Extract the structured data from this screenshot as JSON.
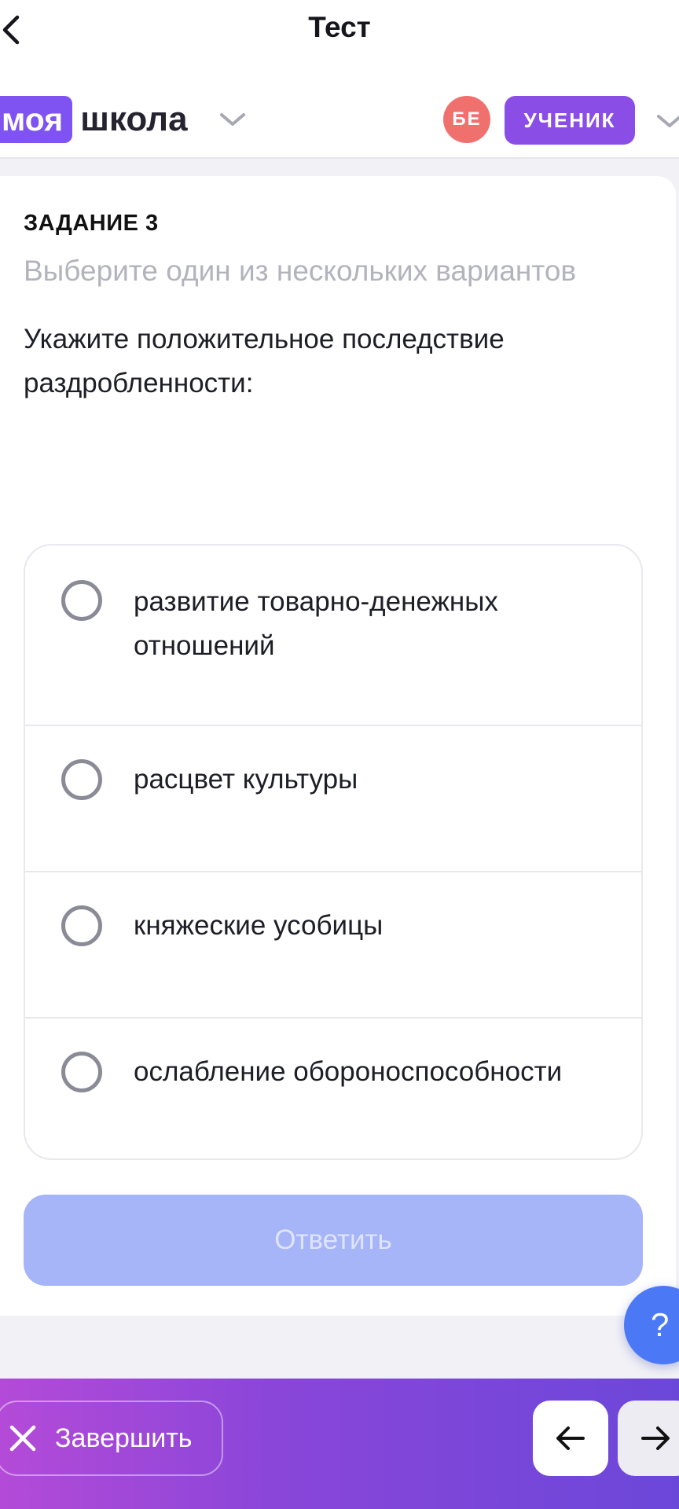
{
  "header": {
    "title": "Тест",
    "logo_badge": "моя",
    "logo_text": "школа",
    "avatar_initials": "БЕ",
    "role": "УЧЕНИК"
  },
  "task": {
    "label": "ЗАДАНИЕ 3",
    "hint": "Выберите один из нескольких вариантов",
    "question": "Укажите положительное последствие раздробленности:",
    "options": [
      {
        "label": "развитие товарно-денежных отношений"
      },
      {
        "label": "расцвет культуры"
      },
      {
        "label": "княжеские усобицы"
      },
      {
        "label": "ослабление обороноспособности"
      }
    ],
    "submit_label": "Ответить"
  },
  "help_label": "?",
  "footer": {
    "finish_label": "Завершить"
  },
  "colors": {
    "accent": "#7f52f2",
    "role_badge": "#8a4ee6",
    "avatar": "#f0706e",
    "submit_disabled": "#a6b4f8",
    "help": "#4b79f5"
  }
}
